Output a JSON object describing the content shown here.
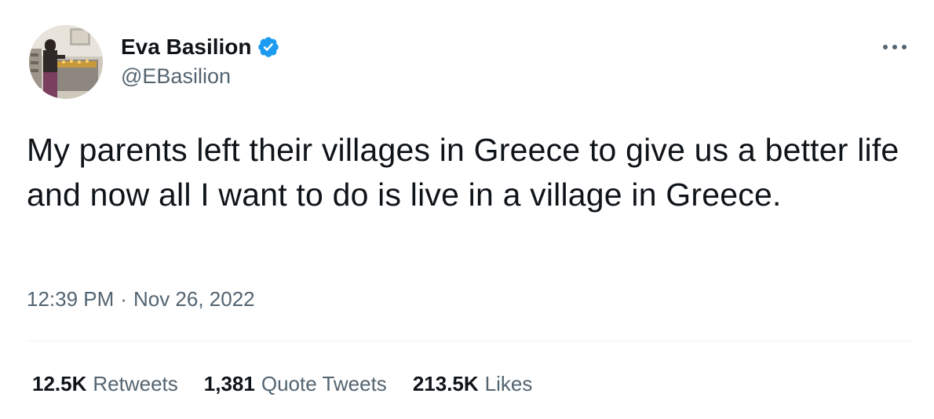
{
  "tweet": {
    "author": {
      "display_name": "Eva Basilion",
      "handle": "@EBasilion",
      "verified": true,
      "verified_color": "#1d9bf0"
    },
    "text": "My parents left their villages in Greece to give us a better life and now all I want to do is live in a village in Greece.",
    "time": "12:39 PM",
    "separator": "·",
    "date": "Nov 26, 2022",
    "more_icon": "ellipsis-icon",
    "stats": {
      "retweets": {
        "count": "12.5K",
        "label": "Retweets"
      },
      "quotes": {
        "count": "1,381",
        "label": "Quote Tweets"
      },
      "likes": {
        "count": "213.5K",
        "label": "Likes"
      }
    }
  },
  "colors": {
    "text_primary": "#0f1419",
    "text_secondary": "#536471",
    "divider": "#eff3f4",
    "background": "#ffffff"
  }
}
